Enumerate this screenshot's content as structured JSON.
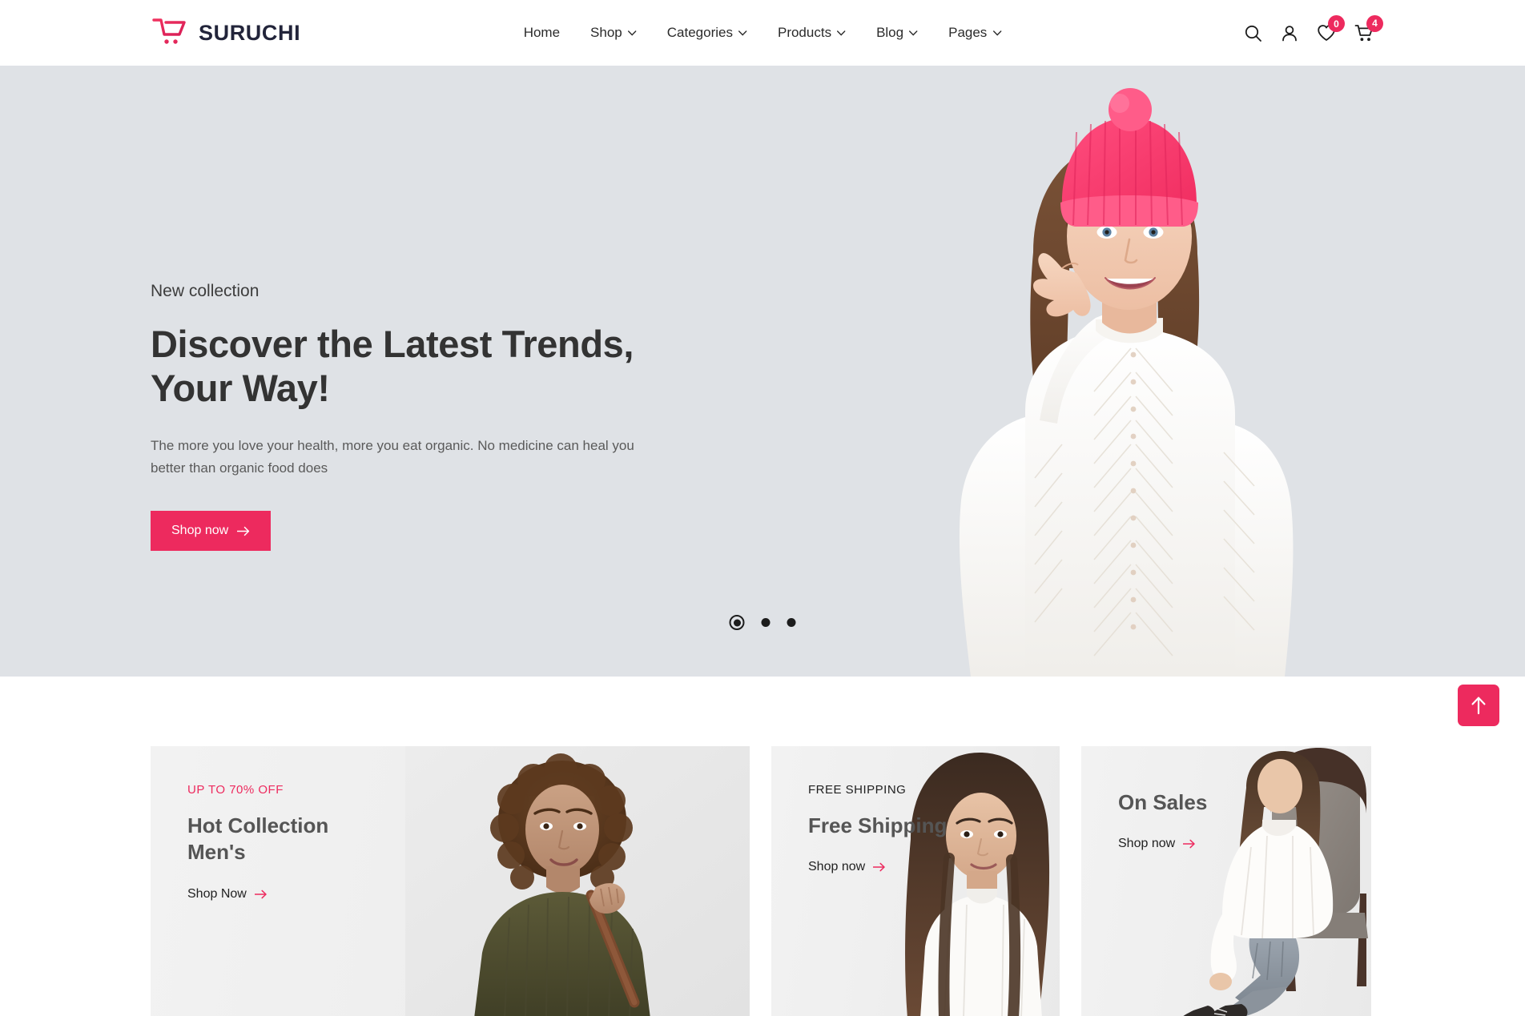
{
  "brand": {
    "name": "SURUCHI",
    "logo_icon": "shopping-cart-icon",
    "accent_color": "#ED2A5E"
  },
  "nav": {
    "items": [
      {
        "label": "Home",
        "has_dropdown": false
      },
      {
        "label": "Shop",
        "has_dropdown": true
      },
      {
        "label": "Categories",
        "has_dropdown": true
      },
      {
        "label": "Products",
        "has_dropdown": true
      },
      {
        "label": "Blog",
        "has_dropdown": true
      },
      {
        "label": "Pages",
        "has_dropdown": true
      }
    ]
  },
  "actions": {
    "search_icon": "search-icon",
    "account_icon": "user-icon",
    "wishlist_icon": "heart-icon",
    "wishlist_count": "0",
    "cart_icon": "shopping-cart-icon",
    "cart_count": "4"
  },
  "hero": {
    "eyebrow": "New collection",
    "title_line1": "Discover the Latest Trends,",
    "title_line2": "Your Way!",
    "description": "The more you love your health, more you eat organic. No medicine can heal you better than organic food does",
    "cta_label": "Shop now",
    "background_color": "#DFE2E6",
    "slides": [
      {
        "active": true
      },
      {
        "active": false
      },
      {
        "active": false
      }
    ]
  },
  "scroll_top": {
    "icon": "arrow-up-icon"
  },
  "promos": {
    "cards": [
      {
        "eyebrow": "UP TO 70% OFF",
        "eyebrow_color": "#ED2A5E",
        "title_line1": "Hot Collection",
        "title_line2": "Men's",
        "link_label": "Shop Now"
      },
      {
        "eyebrow": "FREE SHIPPING",
        "eyebrow_color": "#1f1f1f",
        "title_line1": "Free Shipping",
        "title_line2": "",
        "link_label": "Shop now"
      },
      {
        "eyebrow": "",
        "eyebrow_color": "#1f1f1f",
        "title_line1": "On Sales",
        "title_line2": "",
        "link_label": "Shop now"
      }
    ]
  }
}
